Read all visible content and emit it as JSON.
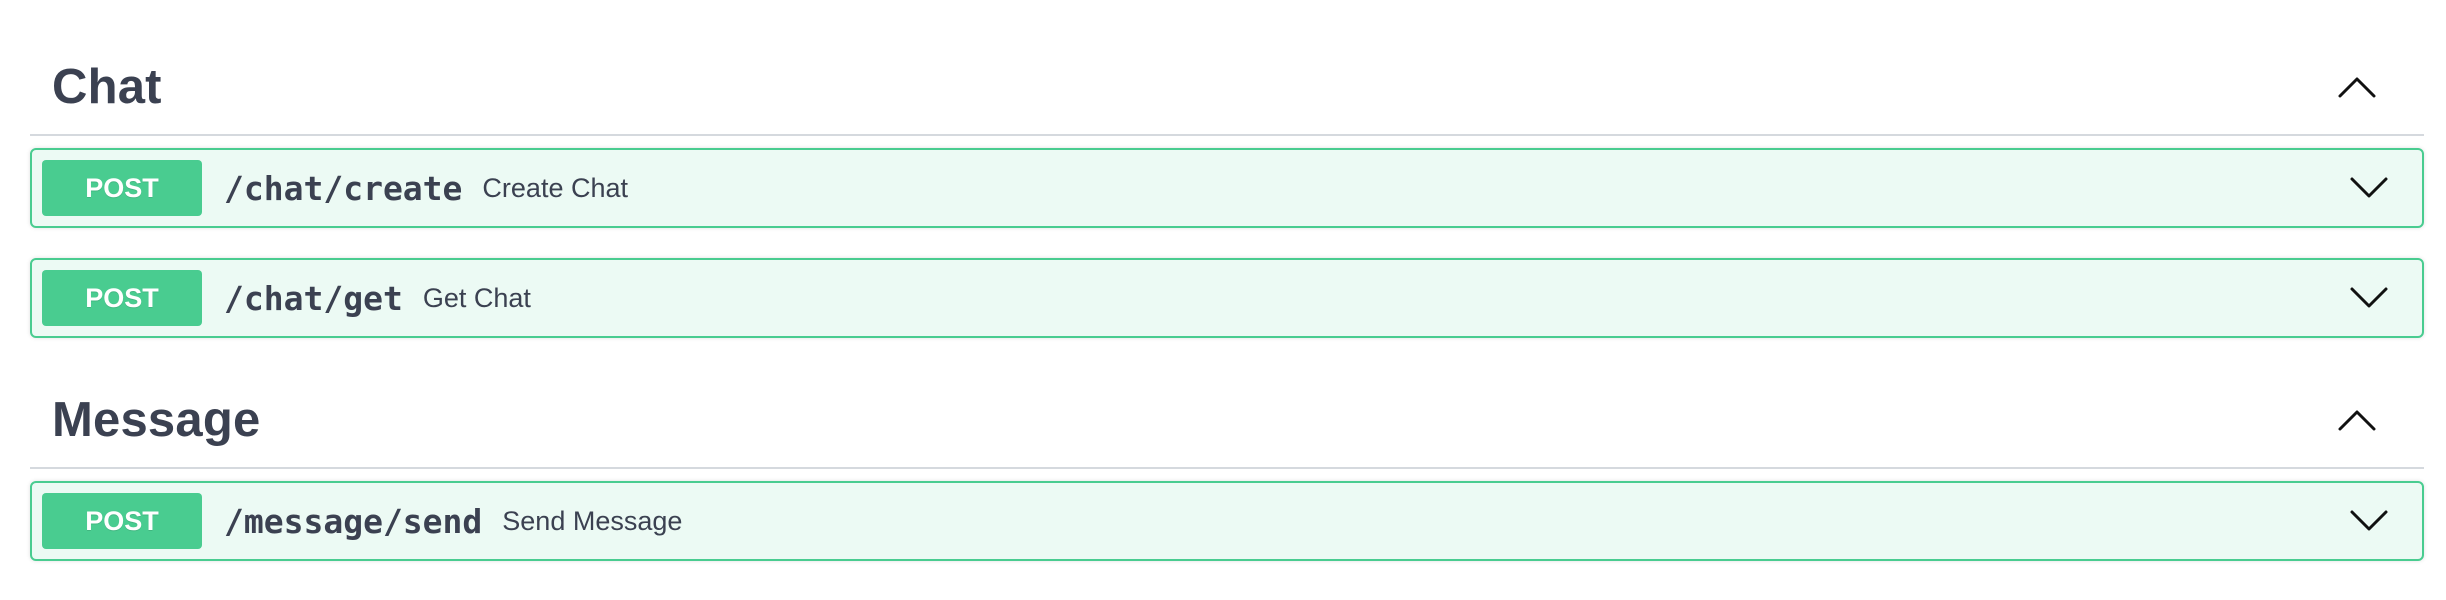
{
  "sections": [
    {
      "title": "Chat",
      "toggle_icon": "chevron-up-icon",
      "operations": [
        {
          "method": "POST",
          "path": "/chat/create",
          "summary": "Create Chat",
          "toggle_icon": "chevron-down-icon"
        },
        {
          "method": "POST",
          "path": "/chat/get",
          "summary": "Get Chat",
          "toggle_icon": "chevron-down-icon"
        }
      ]
    },
    {
      "title": "Message",
      "toggle_icon": "chevron-up-icon",
      "operations": [
        {
          "method": "POST",
          "path": "/message/send",
          "summary": "Send Message",
          "toggle_icon": "chevron-down-icon"
        }
      ]
    }
  ],
  "colors": {
    "post_accent": "#49cc90",
    "post_background": "#edf8f3",
    "text": "#3b4151",
    "divider": "#d5d9de"
  }
}
